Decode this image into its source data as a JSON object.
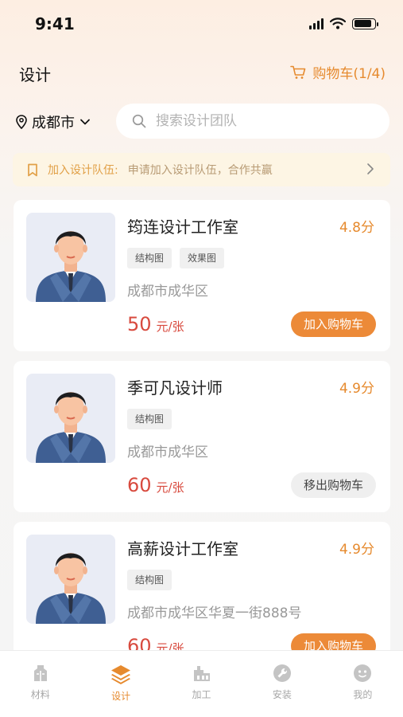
{
  "status": {
    "time": "9:41",
    "battery_level": 0.85
  },
  "header": {
    "title": "设计",
    "cart_label": "购物车(1/4)",
    "cart_icon": "cart-icon"
  },
  "location": {
    "city": "成都市"
  },
  "search": {
    "placeholder": "搜索设计团队"
  },
  "join_banner": {
    "title": "加入设计队伍:",
    "desc": "申请加入设计队伍，合作共赢"
  },
  "designers": [
    {
      "name": "筠连设计工作室",
      "rating": "4.8分",
      "tags": [
        "结构图",
        "效果图"
      ],
      "address": "成都市成华区",
      "price": "50",
      "unit": "元/张",
      "action": "加入购物车",
      "in_cart": false
    },
    {
      "name": "季可凡设计师",
      "rating": "4.9分",
      "tags": [
        "结构图"
      ],
      "address": "成都市成华区",
      "price": "60",
      "unit": "元/张",
      "action": "移出购物车",
      "in_cart": true
    },
    {
      "name": "高薪设计工作室",
      "rating": "4.9分",
      "tags": [
        "结构图"
      ],
      "address": "成都市成华区华夏一街888号",
      "price": "60",
      "unit": "元/张",
      "action": "加入购物车",
      "in_cart": false
    }
  ],
  "tabbar": {
    "items": [
      {
        "label": "材料",
        "icon": "materials-icon",
        "active": false
      },
      {
        "label": "设计",
        "icon": "layers-icon",
        "active": true
      },
      {
        "label": "加工",
        "icon": "factory-icon",
        "active": false
      },
      {
        "label": "安装",
        "icon": "wrench-icon",
        "active": false
      },
      {
        "label": "我的",
        "icon": "profile-icon",
        "active": false
      }
    ]
  },
  "colors": {
    "accent": "#e68a2e",
    "price": "#d84a3e",
    "banner_bg": "#fdf5e4"
  }
}
